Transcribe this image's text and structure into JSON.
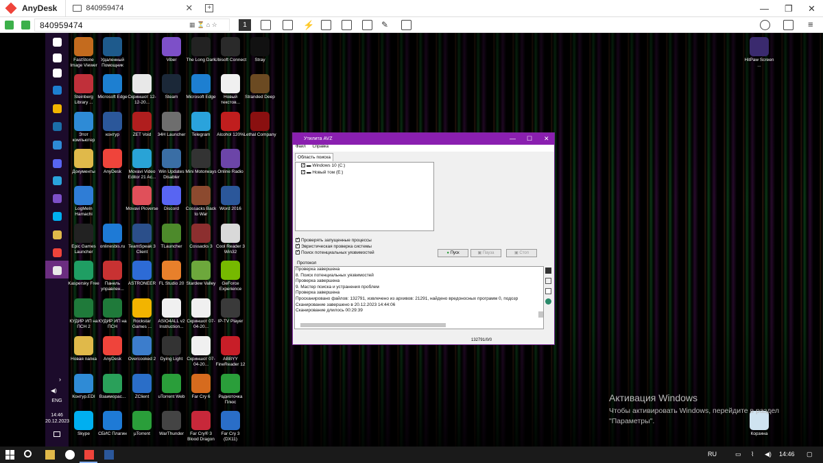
{
  "anydesk": {
    "app_name": "AnyDesk",
    "tab_id": "840959474",
    "address": "840959474",
    "session_num": "1"
  },
  "desktop_icons": [
    {
      "label": "FastStone Image Viewer",
      "color": "#c46b1e"
    },
    {
      "label": "Удаленный Помощник",
      "color": "#1e5a8c"
    },
    {
      "label": "Steinberg Library ...",
      "color": "#c0303a"
    },
    {
      "label": "Microsoft Edge",
      "color": "#1d7fd1"
    },
    {
      "label": "Скриншот 12-12-20...",
      "color": "#e8e8e8"
    },
    {
      "label": "Steam",
      "color": "#1b2838"
    },
    {
      "label": "Этот компьютер",
      "color": "#2e8bd6"
    },
    {
      "label": "контур",
      "color": "#2b579a"
    },
    {
      "label": "ZET Void",
      "color": "#b01e1e"
    },
    {
      "label": "34H Launcher",
      "color": "#6e6e6e"
    },
    {
      "label": "Документы",
      "color": "#e0b94a"
    },
    {
      "label": "AnyDesk",
      "color": "#ef443b"
    },
    {
      "label": "Movavi Video Editor 21 Ac...",
      "color": "#29a3d6"
    },
    {
      "label": "Win Updates Disabler",
      "color": "#3a6ea5"
    },
    {
      "label": "LogMeIn Hamachi",
      "color": "#2f7dd6"
    },
    {
      "label": "Movavi Picverse",
      "color": "#e0505a"
    },
    {
      "label": "Discord",
      "color": "#5865f2"
    },
    {
      "label": "Cossacks Back to War",
      "color": "#8c4a2f"
    },
    {
      "label": "Epic Games Launcher",
      "color": "#222"
    },
    {
      "label": "onlinesbis.ru",
      "color": "#1e7ad6"
    },
    {
      "label": "TeamSpeak 3 Client",
      "color": "#2b4f8a"
    },
    {
      "label": "TLauncher",
      "color": "#4d8a2b"
    },
    {
      "label": "Kaspersky Free",
      "color": "#1f9e63"
    },
    {
      "label": "Панель управлен...",
      "color": "#c83232"
    },
    {
      "label": "ASTRONEER",
      "color": "#2d6bd6"
    },
    {
      "label": "FL Studio 20",
      "color": "#e8802b"
    },
    {
      "label": "КУДИР ИП на ПСН 2",
      "color": "#1f7a3a"
    },
    {
      "label": "КУДИР ИП на ПСН",
      "color": "#1f7a3a"
    },
    {
      "label": "Rockstar Games ...",
      "color": "#f2b400"
    },
    {
      "label": "ASIO4ALL v2 Instruction...",
      "color": "#f0f0f0"
    },
    {
      "label": "Новая папка",
      "color": "#e0b94a"
    },
    {
      "label": "AnyDesk",
      "color": "#ef443b"
    },
    {
      "label": "Overcooked 2",
      "color": "#3c7dcc"
    },
    {
      "label": "Dying Light",
      "color": "#333"
    },
    {
      "label": "Контур.EDI",
      "color": "#2f8bd6"
    },
    {
      "label": "Взаиморас...",
      "color": "#2aa05a"
    },
    {
      "label": "ZClient",
      "color": "#2a6ec8"
    },
    {
      "label": "uTorrent Web",
      "color": "#2a9e3a"
    },
    {
      "label": "Skype",
      "color": "#00aff0"
    },
    {
      "label": "СБИС Плагин",
      "color": "#1e7ad6"
    },
    {
      "label": "µTorrent",
      "color": "#2a9e3a"
    },
    {
      "label": "WarThunder",
      "color": "#444"
    },
    {
      "label": "Viber",
      "color": "#7d50c8"
    },
    {
      "label": "The Long Dark",
      "color": "#222"
    },
    {
      "label": "Ubisoft Connect",
      "color": "#2a2a2a"
    },
    {
      "label": "Stray",
      "color": "#111"
    },
    {
      "label": "Microsoft Edge",
      "color": "#1d7fd1"
    },
    {
      "label": "Новый текстов...",
      "color": "#f0f0f0"
    },
    {
      "label": "Stranded Deep",
      "color": "#6b4a22"
    },
    {
      "label": "Telegram",
      "color": "#2aa3dc"
    },
    {
      "label": "Alcohol 120%",
      "color": "#c01e1e"
    },
    {
      "label": "Lethal Company",
      "color": "#8a1010"
    },
    {
      "label": "Mini Motorways",
      "color": "#333"
    },
    {
      "label": "Online Radio",
      "color": "#6c45a8"
    },
    {
      "label": "Word 2016",
      "color": "#2b579a"
    },
    {
      "label": "Cossacks 3",
      "color": "#8c2f2f"
    },
    {
      "label": "Cool Reader 3 Win32",
      "color": "#d9d9d9"
    },
    {
      "label": "Stardew Valley",
      "color": "#6da83c"
    },
    {
      "label": "GeForce Experience",
      "color": "#76b900"
    },
    {
      "label": "Скриншот 07-04-20...",
      "color": "#f0f0f0"
    },
    {
      "label": "IP-TV Player",
      "color": "#3a3a3a"
    },
    {
      "label": "Скриншот 07-04-20...",
      "color": "#f0f0f0"
    },
    {
      "label": "ABBYY FineReader 12",
      "color": "#c81e28"
    },
    {
      "label": "Far Cry 6",
      "color": "#d66b1e"
    },
    {
      "label": "Радиоточка Плюс",
      "color": "#2a9e3a"
    },
    {
      "label": "Far Cry® 3 Blood Dragon",
      "color": "#c8283a"
    },
    {
      "label": "Far Cry 3 (DX11)",
      "color": "#2a6ec8"
    },
    {
      "label": "HitPaw Screen ...",
      "color": "#3a2a6e"
    },
    {
      "label": "Корзина",
      "color": "#cfe3f0"
    }
  ],
  "avz": {
    "title": "Утилита AVZ",
    "menu": [
      "Файл",
      "Справка"
    ],
    "tab": "Область поиска",
    "drives": [
      "Windows 10 (C:)",
      "Новый том (E:)"
    ],
    "options": [
      "Проверять запущенные процессы",
      "Эвристическая проверка системы",
      "Поиск потенциальных уязвимостей"
    ],
    "buttons": {
      "start": "Пуск",
      "pause": "Пауза",
      "stop": "Стоп"
    },
    "protocol_label": "Протокол",
    "log": [
      "Проверка завершена",
      "8. Поиск потенциальных уязвимостей",
      "Проверка завершена",
      "9. Мастер поиска и устранения проблем",
      "Проверка завершена",
      "Просканировано файлов: 132791, извлечено из архивов: 21291, найдено вредоносных программ 0, подозр",
      "Сканирование завершено в 20.12.2023 14:44:06",
      "Сканирование длилось 00:29:39"
    ],
    "status": "132791/0/0"
  },
  "watermark": {
    "title": "Активация Windows",
    "line1": "Чтобы активировать Windows, перейдите в раздел",
    "line2": "\"Параметры\"."
  },
  "leftbar": {
    "lang": "ENG",
    "time": "14:46",
    "date": "20.12.2023"
  },
  "taskbar": {
    "lang": "RU",
    "time": "14:46"
  }
}
